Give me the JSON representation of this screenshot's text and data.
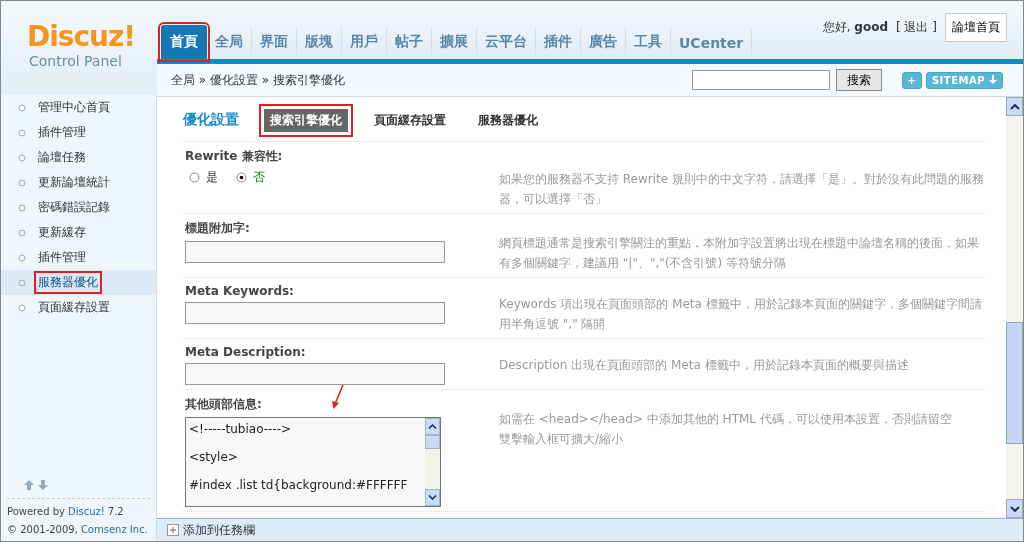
{
  "logo": {
    "title": "Discuz!",
    "subtitle": "Control Panel"
  },
  "nav_tabs": [
    {
      "label": "首頁",
      "selected": true,
      "highlighted": true
    },
    {
      "label": "全局",
      "selected": false,
      "highlighted": false
    },
    {
      "label": "界面",
      "selected": false,
      "highlighted": false
    },
    {
      "label": "版塊",
      "selected": false,
      "highlighted": false
    },
    {
      "label": "用戶",
      "selected": false,
      "highlighted": false
    },
    {
      "label": "帖子",
      "selected": false,
      "highlighted": false
    },
    {
      "label": "擴展",
      "selected": false,
      "highlighted": false
    },
    {
      "label": "云平台",
      "selected": false,
      "highlighted": false
    },
    {
      "label": "插件",
      "selected": false,
      "highlighted": false
    },
    {
      "label": "廣告",
      "selected": false,
      "highlighted": false
    },
    {
      "label": "工具",
      "selected": false,
      "highlighted": false
    },
    {
      "label": "UCenter",
      "selected": false,
      "highlighted": false
    }
  ],
  "user": {
    "greeting": "您好,",
    "name": "good",
    "logout": "[ 退出 ]",
    "forum_home": "論壇首頁"
  },
  "breadcrumb": "全局 » 優化設置 » 搜索引擎優化",
  "search": {
    "button": "搜索"
  },
  "add_button": "+",
  "sitemap_button": "SITEMAP",
  "sidebar": {
    "items": [
      {
        "label": "管理中心首頁",
        "selected": false,
        "highlighted": false
      },
      {
        "label": "插件管理",
        "selected": false,
        "highlighted": false
      },
      {
        "label": "論壇任務",
        "selected": false,
        "highlighted": false
      },
      {
        "label": "更新論壇統計",
        "selected": false,
        "highlighted": false
      },
      {
        "label": "密碼錯誤記錄",
        "selected": false,
        "highlighted": false
      },
      {
        "label": "更新緩存",
        "selected": false,
        "highlighted": false
      },
      {
        "label": "插件管理",
        "selected": false,
        "highlighted": false
      },
      {
        "label": "服務器優化",
        "selected": true,
        "highlighted": true
      },
      {
        "label": "頁面緩存設置",
        "selected": false,
        "highlighted": false
      }
    ]
  },
  "footer": {
    "powered": "Powered by",
    "product": "Discuz!",
    "version": "7.2",
    "copyright": "© 2001-2009,",
    "company": "Comsenz Inc."
  },
  "section": {
    "title": "優化設置",
    "tabs": [
      {
        "label": "搜索引擎優化",
        "selected": true,
        "highlighted": true
      },
      {
        "label": "頁面緩存設置",
        "selected": false,
        "highlighted": false
      },
      {
        "label": "服務器優化",
        "selected": false,
        "highlighted": false
      }
    ]
  },
  "settings": [
    {
      "kind": "radio",
      "label": "Rewrite 兼容性:",
      "options": [
        {
          "label": "是",
          "selected": false
        },
        {
          "label": "否",
          "selected": true
        }
      ],
      "help": [
        "如果您的服務器不支持 Rewrite 規則中的中文字符，請選擇「是」。對於沒有此問題的服務器，可以選擇「否」"
      ]
    },
    {
      "kind": "text",
      "label": "標題附加字:",
      "help": [
        "網頁標題通常是搜索引擎關注的重點，本附加字設置將出現在標題中論壇名稱的後面，如果有多個關鍵字，建議用 \"|\"、\",\"(不含引號) 等符號分隔"
      ]
    },
    {
      "kind": "text",
      "label": "Meta Keywords:",
      "help": [
        "Keywords 項出現在頁面頭部的 Meta 標籤中，用於記錄本頁面的關鍵字，多個關鍵字間請用半角逗號 \",\" 隔開"
      ]
    },
    {
      "kind": "text",
      "label": "Meta Description:",
      "help": [
        "Description 出現在頁面頭部的 Meta 標籤中，用於記錄本頁面的概要與描述"
      ]
    },
    {
      "kind": "textarea",
      "label": "其他頭部信息:",
      "value": "<!-----tubiao---->\n\n<style>\n\n#index .list td{background:#FFFFFF",
      "help": [
        "如需在 <head></head> 中添加其他的 HTML 代碼，可以使用本設置，否則請留空",
        "雙擊輸入框可擴大/縮小"
      ]
    }
  ],
  "taskbar": {
    "label": "添加到任務欄"
  }
}
